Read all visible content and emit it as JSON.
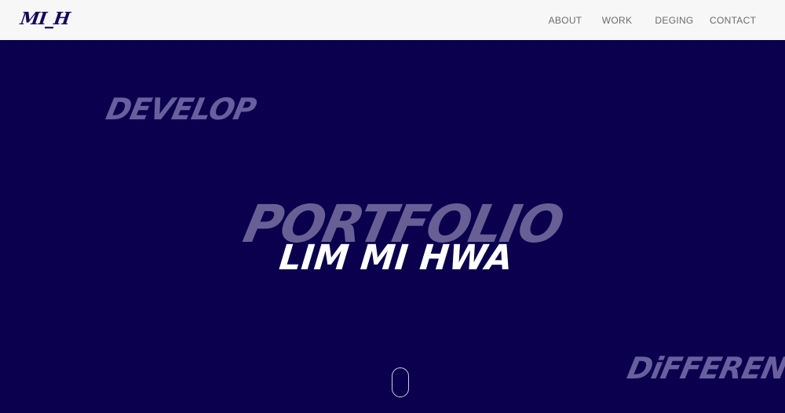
{
  "header": {
    "logo_text": "MI_H",
    "nav": [
      {
        "label": "ABOUT"
      },
      {
        "label": "WORK"
      },
      {
        "label": "DEGING"
      },
      {
        "label": "CONTACT"
      }
    ]
  },
  "hero": {
    "decor_words": {
      "develop": "DEVELOP",
      "portfolio": "PORTFOLIO",
      "different": "DiFFERENT"
    },
    "name": "LIM MI HWA",
    "scroll_icon": "mouse-scroll-icon"
  },
  "colors": {
    "background": "#0a004e",
    "header_bg": "#f7f7f7",
    "logo": "#14085a",
    "decor_text": "#6a5f9e",
    "name_text": "#ffffff",
    "nav_text": "#6b6b6b"
  }
}
